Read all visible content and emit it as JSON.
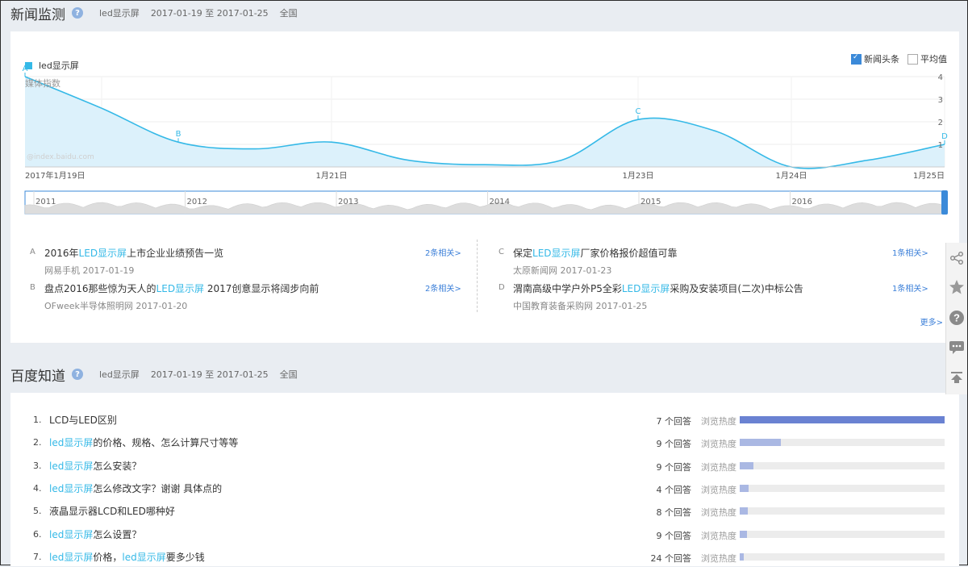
{
  "news_section": {
    "title": "新闻监测",
    "keyword": "led显示屏",
    "date_range": "2017-01-19 至 2017-01-25",
    "region": "全国"
  },
  "chart": {
    "legend": "led显示屏",
    "ylabel": "媒体指数",
    "watermark": "@index.baidu.com",
    "checkbox_headlines": "新闻头条",
    "checkbox_average": "平均值",
    "headlines_checked": true,
    "average_checked": false,
    "line_color": "#35b9e7",
    "fill_color": "#dcf1fb"
  },
  "chart_data": {
    "type": "area",
    "x": [
      "2017-01-19",
      "2017-01-19.5",
      "2017-01-20",
      "2017-01-20.5",
      "2017-01-21",
      "2017-01-21.5",
      "2017-01-22",
      "2017-01-22.5",
      "2017-01-23",
      "2017-01-23.5",
      "2017-01-24",
      "2017-01-24.5",
      "2017-01-25"
    ],
    "y": [
      4.0,
      2.6,
      1.1,
      0.8,
      1.1,
      0.3,
      0.1,
      0.3,
      2.1,
      1.6,
      0.0,
      0.3,
      1.0
    ],
    "xticks": [
      "2017年1月19日",
      "1月21日",
      "1月23日",
      "1月24日",
      "1月25日"
    ],
    "yticks": [
      "4",
      "3",
      "2",
      "1"
    ],
    "ylim": [
      0,
      4
    ],
    "markers": [
      {
        "label": "A",
        "x": "2017-01-19",
        "y": 4.0
      },
      {
        "label": "B",
        "x": "2017-01-20",
        "y": 1.1
      },
      {
        "label": "C",
        "x": "2017-01-23",
        "y": 2.1
      },
      {
        "label": "D",
        "x": "2017-01-25",
        "y": 1.0
      }
    ],
    "overview_years": [
      "2011",
      "2012",
      "2013",
      "2014",
      "2015",
      "2016"
    ]
  },
  "news": [
    {
      "letter": "A",
      "pre": "2016年",
      "hl": "LED显示屏",
      "post": "上市企业业绩预告一览",
      "source": "网易手机 2017-01-19",
      "related": "2条相关>"
    },
    {
      "letter": "B",
      "pre": "盘点2016那些惊为天人的",
      "hl": "LED显示屏",
      "post": " 2017创意显示将阔步向前",
      "source": "OFweek半导体照明网 2017-01-20",
      "related": "2条相关>"
    },
    {
      "letter": "C",
      "pre": "保定",
      "hl": "LED显示屏",
      "post": "厂家价格报价超值可靠",
      "source": "太原新闻网 2017-01-23",
      "related": "1条相关>"
    },
    {
      "letter": "D",
      "pre": "渭南高级中学户外P5全彩",
      "hl": "LED显示屏",
      "post": "采购及安装项目(二次)中标公告",
      "source": "中国教育装备采购网 2017-01-25",
      "related": "1条相关>"
    }
  ],
  "more": "更多>",
  "zhidao_section": {
    "title": "百度知道",
    "keyword": "led显示屏",
    "date_range": "2017-01-19 至 2017-01-25",
    "region": "全国",
    "heat_label": "浏览热度"
  },
  "questions": [
    {
      "num": "1.",
      "parts": [
        [
          "LCD与LED区别",
          false
        ]
      ],
      "answers": "7 个回答",
      "heat": 1.0
    },
    {
      "num": "2.",
      "parts": [
        [
          "led显示屏",
          true
        ],
        [
          "的价格、规格、怎么计算尺寸等等",
          false
        ]
      ],
      "answers": "9 个回答",
      "heat": 0.2
    },
    {
      "num": "3.",
      "parts": [
        [
          "led显示屏",
          true
        ],
        [
          "怎么安装？",
          false
        ]
      ],
      "answers": "9 个回答",
      "heat": 0.065
    },
    {
      "num": "4.",
      "parts": [
        [
          "led显示屏",
          true
        ],
        [
          "怎么修改文字？谢谢 具体点的",
          false
        ]
      ],
      "answers": "4 个回答",
      "heat": 0.045
    },
    {
      "num": "5.",
      "parts": [
        [
          "液晶显示器LCD和LED哪种好",
          false
        ]
      ],
      "answers": "8 个回答",
      "heat": 0.04
    },
    {
      "num": "6.",
      "parts": [
        [
          "led显示屏",
          true
        ],
        [
          "怎么设置？",
          false
        ]
      ],
      "answers": "9 个回答",
      "heat": 0.035
    },
    {
      "num": "7.",
      "parts": [
        [
          "led显示屏",
          true
        ],
        [
          "价格，",
          false
        ],
        [
          "led显示屏",
          true
        ],
        [
          "要多少钱",
          false
        ]
      ],
      "answers": "24 个回答",
      "heat": 0.02
    }
  ],
  "side_tools": [
    "share-icon",
    "star-icon",
    "help-icon",
    "comment-icon",
    "back-to-top-icon"
  ]
}
